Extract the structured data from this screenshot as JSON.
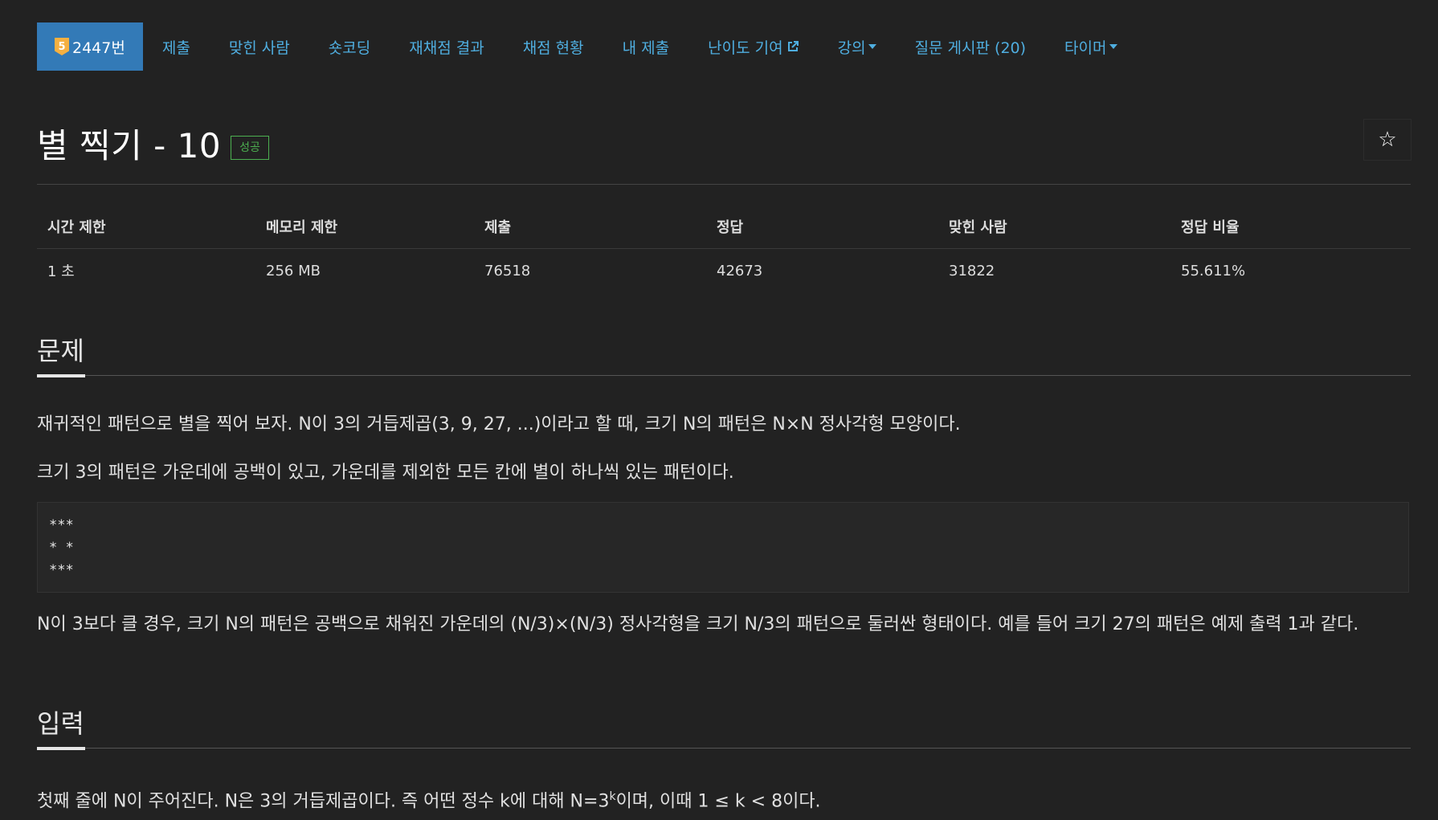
{
  "nav": {
    "problem_id_label": "2447번",
    "tier_number": "5",
    "items": [
      {
        "label": "제출"
      },
      {
        "label": "맞힌 사람"
      },
      {
        "label": "숏코딩"
      },
      {
        "label": "재채점 결과"
      },
      {
        "label": "채점 현황"
      },
      {
        "label": "내 제출"
      },
      {
        "label": "난이도 기여"
      },
      {
        "label": "강의"
      },
      {
        "label": "질문 게시판 (20)"
      },
      {
        "label": "타이머"
      }
    ]
  },
  "problem": {
    "title": "별 찍기 - 10",
    "status_label": "성공",
    "star_icon": "☆"
  },
  "stats": {
    "headers": [
      "시간 제한",
      "메모리 제한",
      "제출",
      "정답",
      "맞힌 사람",
      "정답 비율"
    ],
    "values": [
      "1 초",
      "256 MB",
      "76518",
      "42673",
      "31822",
      "55.611%"
    ]
  },
  "sections": {
    "description": {
      "heading": "문제",
      "p1": "재귀적인 패턴으로 별을 찍어 보자. N이 3의 거듭제곱(3, 9, 27, ...)이라고 할 때, 크기 N의 패턴은 N×N 정사각형 모양이다.",
      "p2": "크기 3의 패턴은 가운데에 공백이 있고, 가운데를 제외한 모든 칸에 별이 하나씩 있는 패턴이다.",
      "pattern": "***\n* *\n***",
      "p3": "N이 3보다 클 경우, 크기 N의 패턴은 공백으로 채워진 가운데의 (N/3)×(N/3) 정사각형을 크기 N/3의 패턴으로 둘러싼 형태이다. 예를 들어 크기 27의 패턴은 예제 출력 1과 같다."
    },
    "input": {
      "heading": "입력",
      "p1_before": "첫째 줄에 N이 주어진다. N은 3의 거듭제곱이다. 즉 어떤 정수 k에 대해 N=3",
      "p1_sup": "k",
      "p1_after": "이며, 이때 1 ≤ k < 8이다."
    }
  }
}
